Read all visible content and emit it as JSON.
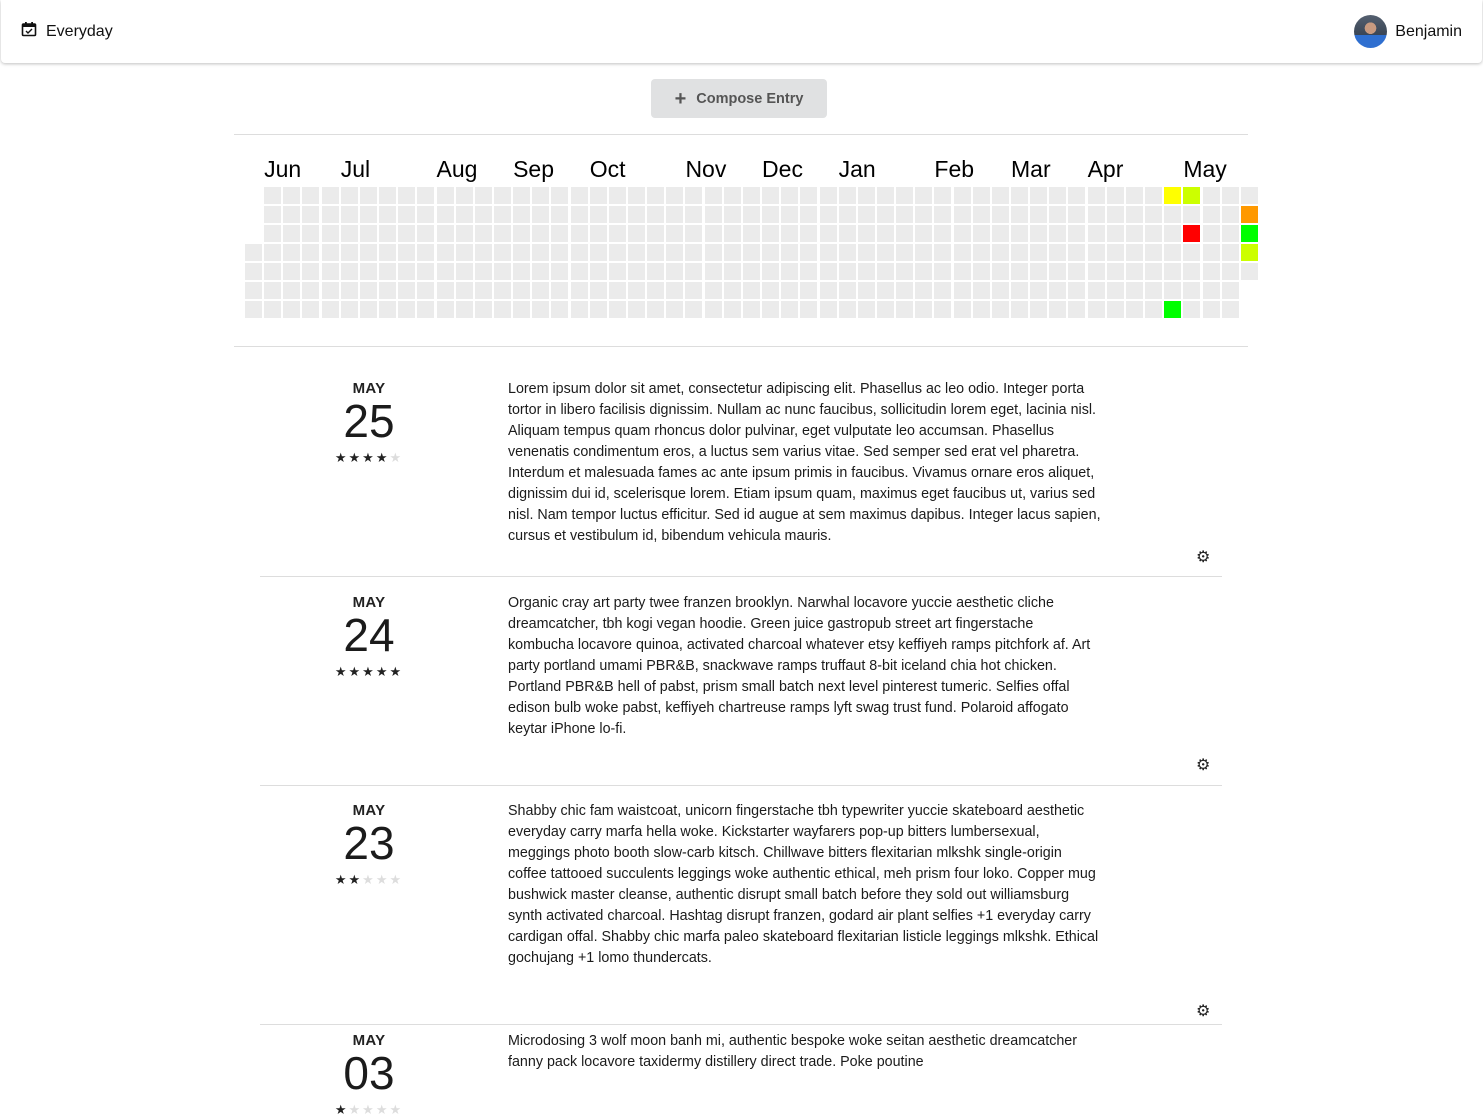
{
  "header": {
    "app_title": "Everyday",
    "app_icon": "calendar-check-icon",
    "user_name": "Benjamin"
  },
  "compose": {
    "label": "Compose Entry",
    "icon": "plus-icon"
  },
  "heatmap": {
    "months": [
      {
        "label": "Jun",
        "week": 1
      },
      {
        "label": "Jul",
        "week": 5
      },
      {
        "label": "Aug",
        "week": 10
      },
      {
        "label": "Sep",
        "week": 14
      },
      {
        "label": "Oct",
        "week": 18
      },
      {
        "label": "Nov",
        "week": 23
      },
      {
        "label": "Dec",
        "week": 27
      },
      {
        "label": "Jan",
        "week": 31
      },
      {
        "label": "Feb",
        "week": 36
      },
      {
        "label": "Mar",
        "week": 40
      },
      {
        "label": "Apr",
        "week": 44
      },
      {
        "label": "May",
        "week": 49
      }
    ],
    "total_days": 366,
    "first_weekday": 3,
    "empty_color": "#ebebeb",
    "rating_colors": {
      "1": "#ff0000",
      "2": "#ff9900",
      "3": "#ffff00",
      "4": "#ccff00",
      "5": "#00ff00"
    },
    "rated_days": [
      {
        "day": 333,
        "rating": 3
      },
      {
        "day": 339,
        "rating": 5
      },
      {
        "day": 340,
        "rating": 4
      },
      {
        "day": 342,
        "rating": 1
      },
      {
        "day": 362,
        "rating": 2
      },
      {
        "day": 363,
        "rating": 5
      },
      {
        "day": 364,
        "rating": 4
      }
    ]
  },
  "entries": [
    {
      "month": "MAY",
      "day": "25",
      "rating": 4,
      "text": "Lorem ipsum dolor sit amet, consectetur adipiscing elit. Phasellus ac leo odio. Integer porta tortor in libero facilisis dignissim. Nullam ac nunc faucibus, sollicitudin lorem eget, lacinia nisl. Aliquam tempus quam rhoncus dolor pulvinar, eget vulputate leo accumsan. Phasellus venenatis condimentum eros, a luctus sem varius vitae. Sed semper sed erat vel pharetra. Interdum et malesuada fames ac ante ipsum primis in faucibus. Vivamus ornare eros aliquet, dignissim dui id, scelerisque lorem. Etiam ipsum quam, maximus eget faucibus ut, varius sed nisl. Nam tempor luctus efficitur. Sed id augue at sem maximus dapibus. Integer lacus sapien, cursus et vestibulum id, bibendum vehicula mauris."
    },
    {
      "month": "MAY",
      "day": "24",
      "rating": 5,
      "text": "Organic cray art party twee franzen brooklyn. Narwhal locavore yuccie aesthetic cliche dreamcatcher, tbh kogi vegan hoodie. Green juice gastropub street art fingerstache kombucha locavore quinoa, activated charcoal whatever etsy keffiyeh ramps pitchfork af. Art party portland umami PBR&B, snackwave ramps truffaut 8-bit iceland chia hot chicken. Portland PBR&B hell of pabst, prism small batch next level pinterest tumeric. Selfies offal edison bulb woke pabst, keffiyeh chartreuse ramps lyft swag trust fund. Polaroid affogato keytar iPhone lo-fi."
    },
    {
      "month": "MAY",
      "day": "23",
      "rating": 2,
      "text": "Shabby chic fam waistcoat, unicorn fingerstache tbh typewriter yuccie skateboard aesthetic everyday carry marfa hella woke. Kickstarter wayfarers pop-up bitters lumbersexual, meggings photo booth slow-carb kitsch. Chillwave bitters flexitarian mlkshk single-origin coffee tattooed succulents leggings woke authentic ethical, meh prism four loko. Copper mug bushwick master cleanse, authentic disrupt small batch before they sold out williamsburg synth activated charcoal. Hashtag disrupt franzen, godard air plant selfies +1 everyday carry cardigan offal. Shabby chic marfa paleo skateboard flexitarian listicle leggings mlkshk. Ethical gochujang +1 lomo thundercats."
    },
    {
      "month": "MAY",
      "day": "03",
      "rating": 1,
      "text": "Microdosing 3 wolf moon banh mi, authentic bespoke woke seitan aesthetic dreamcatcher fanny pack locavore taxidermy distillery direct trade. Poke poutine"
    }
  ]
}
